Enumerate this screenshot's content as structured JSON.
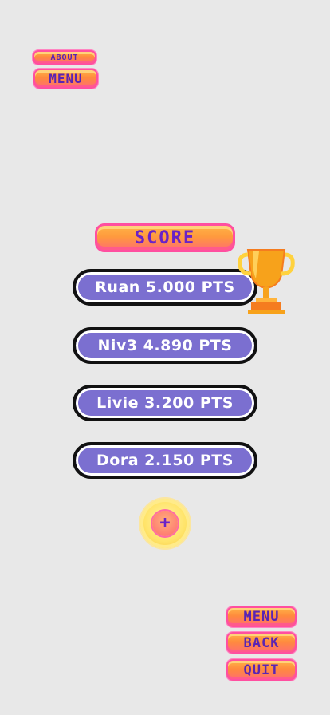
{
  "top_nav": {
    "about_label": "ABOUT",
    "menu_label": "MENU"
  },
  "score_title": "SCORE",
  "leaderboard": [
    {
      "name": "Ruan",
      "points": "5.000",
      "unit": "PTS",
      "text": "Ruan 5.000 PTS"
    },
    {
      "name": "Niv3",
      "points": "4.890",
      "unit": "PTS",
      "text": "Niv3 4.890 PTS"
    },
    {
      "name": "Livie",
      "points": "3.200",
      "unit": "PTS",
      "text": "Livie 3.200 PTS"
    },
    {
      "name": "Dora",
      "points": "2.150",
      "unit": "PTS",
      "text": "Dora 2.150 PTS"
    }
  ],
  "add_button_icon": "plus-icon",
  "add_button_glyph": "+",
  "bottom_nav": {
    "menu_label": "MENU",
    "back_label": "BACK",
    "quit_label": "QUIT"
  },
  "colors": {
    "background": "#e8e8e8",
    "button_text": "#5a24b4",
    "score_row_fill": "#7b6fd0",
    "button_gradient_top": "#ffb347",
    "button_gradient_bottom": "#ff6f6f",
    "button_border": "#ff4fa0",
    "trophy": "#f7a21b",
    "coin": "#ffe46a"
  }
}
